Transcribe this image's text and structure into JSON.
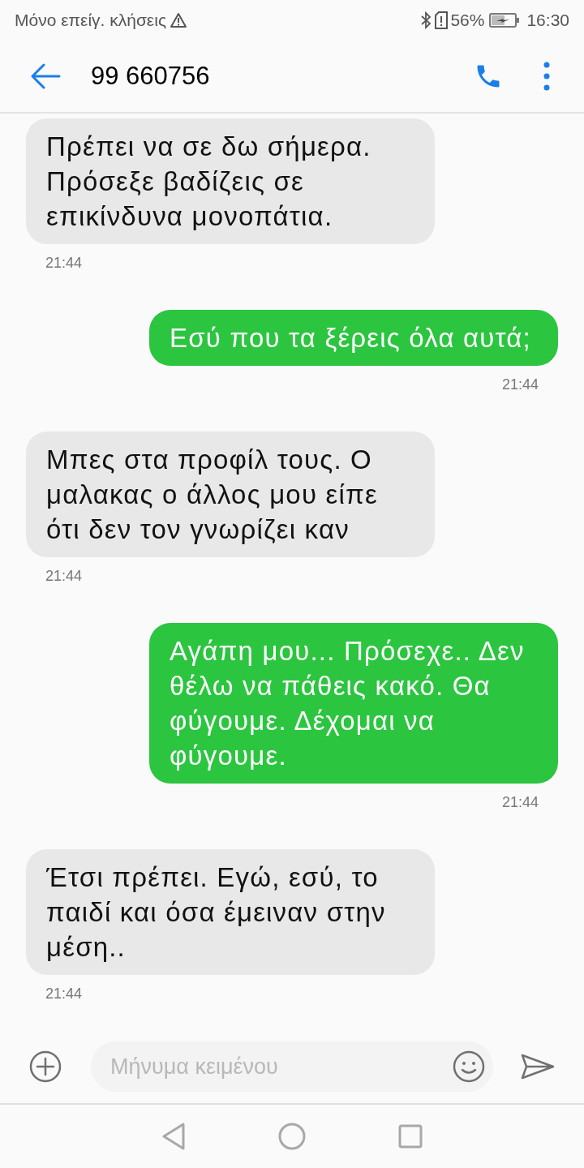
{
  "status_bar": {
    "carrier": "Μόνο επείγ. κλήσεις",
    "battery": "56%",
    "time": "16:30"
  },
  "header": {
    "title": "99 660756"
  },
  "messages": [
    {
      "kind": "incoming",
      "text": "Πρέπει να σε δω σήμερα. Πρόσεξε βαδίζεις σε επικίνδυνα μονοπάτια.",
      "time": "21:44"
    },
    {
      "kind": "outgoing",
      "text": "Εσύ που τα ξέρεις όλα αυτά;",
      "time": "21:44"
    },
    {
      "kind": "incoming",
      "text": "Μπες στα προφίλ τους. Ο μαλακας ο άλλος μου είπε ότι δεν τον γνωρίζει καν",
      "time": "21:44"
    },
    {
      "kind": "outgoing",
      "text": "Αγάπη μου... Πρόσεχε.. Δεν θέλω να πάθεις κακό. Θα φύγουμε. Δέχομαι να φύγουμε.",
      "time": "21:44"
    },
    {
      "kind": "incoming",
      "text": "Έτσι πρέπει. Εγώ, εσύ, το παιδί και όσα έμειναν στην μέση..",
      "time": "21:44"
    }
  ],
  "composer": {
    "placeholder": "Μήνυμα κειμένου"
  }
}
